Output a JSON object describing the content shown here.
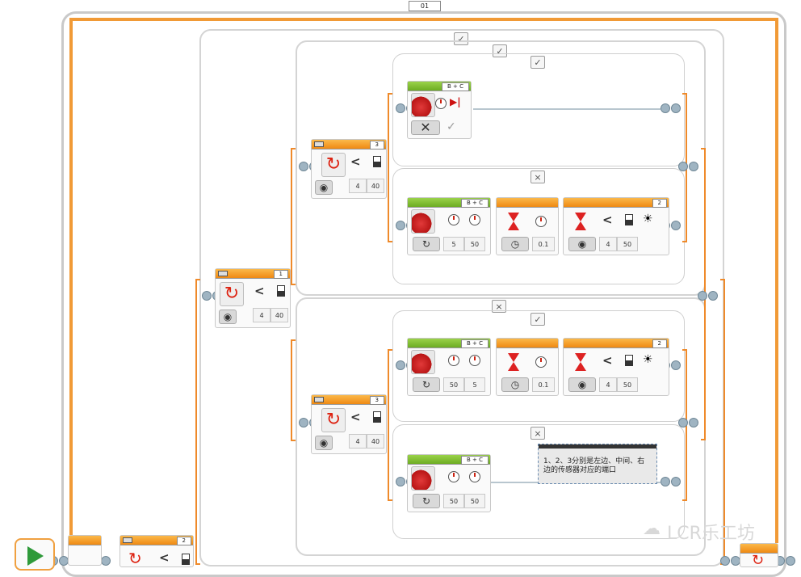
{
  "outer_loop": {
    "label": "01"
  },
  "switch_marks": {
    "true_mark": "✓",
    "false_mark": "×"
  },
  "blocks": {
    "switch1": {
      "port": "1",
      "compare": "<",
      "param_a": "4",
      "param_b": "40"
    },
    "switch3_top": {
      "port": "3",
      "compare": "<",
      "param_a": "4",
      "param_b": "40"
    },
    "switch3_bottom": {
      "port": "3",
      "compare": "<",
      "param_a": "4",
      "param_b": "40"
    },
    "motor_stop": {
      "ports": "B + C"
    },
    "motor_t2": {
      "ports": "B + C",
      "p1": "5",
      "p2": "50"
    },
    "wait_t2": {
      "value": "0.1"
    },
    "wait_sensor_t2": {
      "port": "2",
      "compare": "<",
      "param_a": "4",
      "param_b": "50"
    },
    "motor_b1": {
      "ports": "B + C",
      "p1": "50",
      "p2": "5"
    },
    "wait_b1": {
      "value": "0.1"
    },
    "wait_sensor_b1": {
      "port": "2",
      "compare": "<",
      "param_a": "4",
      "param_b": "50"
    },
    "motor_b2": {
      "ports": "B + C",
      "p1": "50",
      "p2": "50"
    },
    "bottom_switch": {
      "port": "2",
      "compare": "<"
    }
  },
  "comment": {
    "text": "1、2、3分别是左边、中间、右边的传感器对应的端口"
  },
  "watermark": {
    "text": "LCR乐工坊"
  },
  "colors": {
    "loop_orange": "#f19a36",
    "motor_green": "#7cbf2c",
    "frame_gray": "#d4d4d4"
  },
  "icons": [
    "play-icon",
    "steering-wheel-icon",
    "motor-icon",
    "timer-icon",
    "rotation-icon",
    "sensor-icon"
  ]
}
